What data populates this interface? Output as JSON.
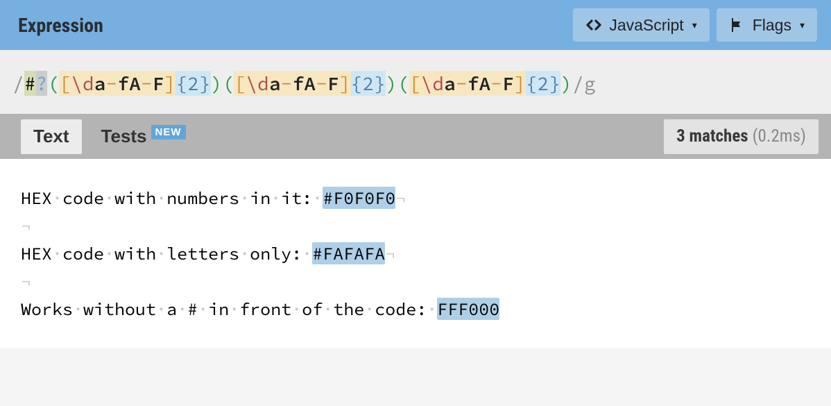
{
  "header": {
    "title": "Expression",
    "flavor_label": "JavaScript",
    "flags_label": "Flags"
  },
  "expression": {
    "open_delim": "/",
    "close_delim": "/",
    "flags": "g",
    "tokens": [
      {
        "t": "char",
        "v": "#"
      },
      {
        "t": "quant",
        "v": "?"
      },
      {
        "t": "gopen",
        "v": "("
      },
      {
        "t": "setopen",
        "v": "["
      },
      {
        "t": "esc",
        "v": "\\d"
      },
      {
        "t": "lit",
        "v": "a"
      },
      {
        "t": "range",
        "v": "-"
      },
      {
        "t": "lit",
        "v": "f"
      },
      {
        "t": "lit",
        "v": "A"
      },
      {
        "t": "range",
        "v": "-"
      },
      {
        "t": "lit",
        "v": "F"
      },
      {
        "t": "setclose",
        "v": "]"
      },
      {
        "t": "qopen",
        "v": "{"
      },
      {
        "t": "num",
        "v": "2"
      },
      {
        "t": "qclose",
        "v": "}"
      },
      {
        "t": "gclose",
        "v": ")"
      },
      {
        "t": "gopen",
        "v": "("
      },
      {
        "t": "setopen",
        "v": "["
      },
      {
        "t": "esc",
        "v": "\\d"
      },
      {
        "t": "lit",
        "v": "a"
      },
      {
        "t": "range",
        "v": "-"
      },
      {
        "t": "lit",
        "v": "f"
      },
      {
        "t": "lit",
        "v": "A"
      },
      {
        "t": "range",
        "v": "-"
      },
      {
        "t": "lit",
        "v": "F"
      },
      {
        "t": "setclose",
        "v": "]"
      },
      {
        "t": "qopen",
        "v": "{"
      },
      {
        "t": "num",
        "v": "2"
      },
      {
        "t": "qclose",
        "v": "}"
      },
      {
        "t": "gclose",
        "v": ")"
      },
      {
        "t": "gopen",
        "v": "("
      },
      {
        "t": "setopen",
        "v": "["
      },
      {
        "t": "esc",
        "v": "\\d"
      },
      {
        "t": "lit",
        "v": "a"
      },
      {
        "t": "range",
        "v": "-"
      },
      {
        "t": "lit",
        "v": "f"
      },
      {
        "t": "lit",
        "v": "A"
      },
      {
        "t": "range",
        "v": "-"
      },
      {
        "t": "lit",
        "v": "F"
      },
      {
        "t": "setclose",
        "v": "]"
      },
      {
        "t": "qopen",
        "v": "{"
      },
      {
        "t": "num",
        "v": "2"
      },
      {
        "t": "qclose",
        "v": "}"
      },
      {
        "t": "gclose",
        "v": ")"
      }
    ]
  },
  "tabs": {
    "text": "Text",
    "tests": "Tests",
    "new_badge": "NEW",
    "active": "text"
  },
  "results": {
    "count_label": "3 matches",
    "time_label": "(0.2ms)"
  },
  "test_lines": [
    {
      "segs": [
        {
          "k": "w",
          "v": "HEX"
        },
        {
          "k": "s"
        },
        {
          "k": "w",
          "v": "code"
        },
        {
          "k": "s"
        },
        {
          "k": "w",
          "v": "with"
        },
        {
          "k": "s"
        },
        {
          "k": "w",
          "v": "numbers"
        },
        {
          "k": "s"
        },
        {
          "k": "w",
          "v": "in"
        },
        {
          "k": "s"
        },
        {
          "k": "w",
          "v": "it:"
        },
        {
          "k": "s"
        },
        {
          "k": "m",
          "v": "#F0F0F0"
        },
        {
          "k": "eol"
        }
      ]
    },
    {
      "segs": [
        {
          "k": "eol"
        }
      ]
    },
    {
      "segs": [
        {
          "k": "w",
          "v": "HEX"
        },
        {
          "k": "s"
        },
        {
          "k": "w",
          "v": "code"
        },
        {
          "k": "s"
        },
        {
          "k": "w",
          "v": "with"
        },
        {
          "k": "s"
        },
        {
          "k": "w",
          "v": "letters"
        },
        {
          "k": "s"
        },
        {
          "k": "w",
          "v": "only:"
        },
        {
          "k": "s"
        },
        {
          "k": "m",
          "v": "#FAFAFA"
        },
        {
          "k": "eol"
        }
      ]
    },
    {
      "segs": [
        {
          "k": "eol"
        }
      ]
    },
    {
      "segs": [
        {
          "k": "w",
          "v": "Works"
        },
        {
          "k": "s"
        },
        {
          "k": "w",
          "v": "without"
        },
        {
          "k": "s"
        },
        {
          "k": "w",
          "v": "a"
        },
        {
          "k": "s"
        },
        {
          "k": "w",
          "v": "#"
        },
        {
          "k": "s"
        },
        {
          "k": "w",
          "v": "in"
        },
        {
          "k": "s"
        },
        {
          "k": "w",
          "v": "front"
        },
        {
          "k": "s"
        },
        {
          "k": "w",
          "v": "of"
        },
        {
          "k": "s"
        },
        {
          "k": "w",
          "v": "the"
        },
        {
          "k": "s"
        },
        {
          "k": "w",
          "v": "code:"
        },
        {
          "k": "s"
        },
        {
          "k": "m",
          "v": "FFF000"
        }
      ]
    }
  ]
}
